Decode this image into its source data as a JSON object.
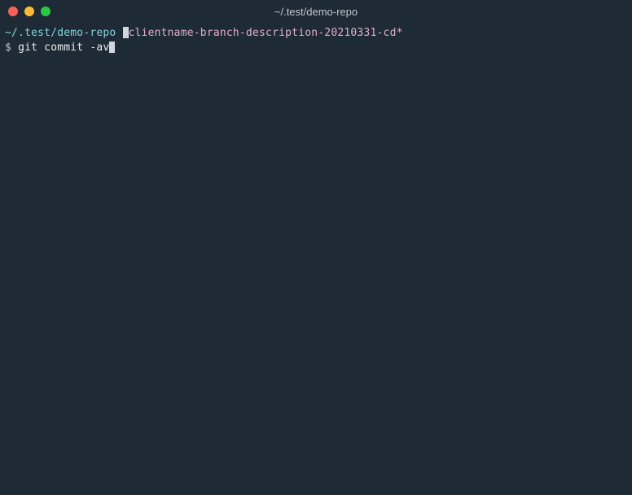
{
  "window": {
    "title": "~/.test/demo-repo"
  },
  "prompt": {
    "cwd": "~/.test/demo-repo",
    "branch": "clientname-branch-description-20210331-cd*",
    "symbol": "$",
    "command": "git commit -av"
  }
}
